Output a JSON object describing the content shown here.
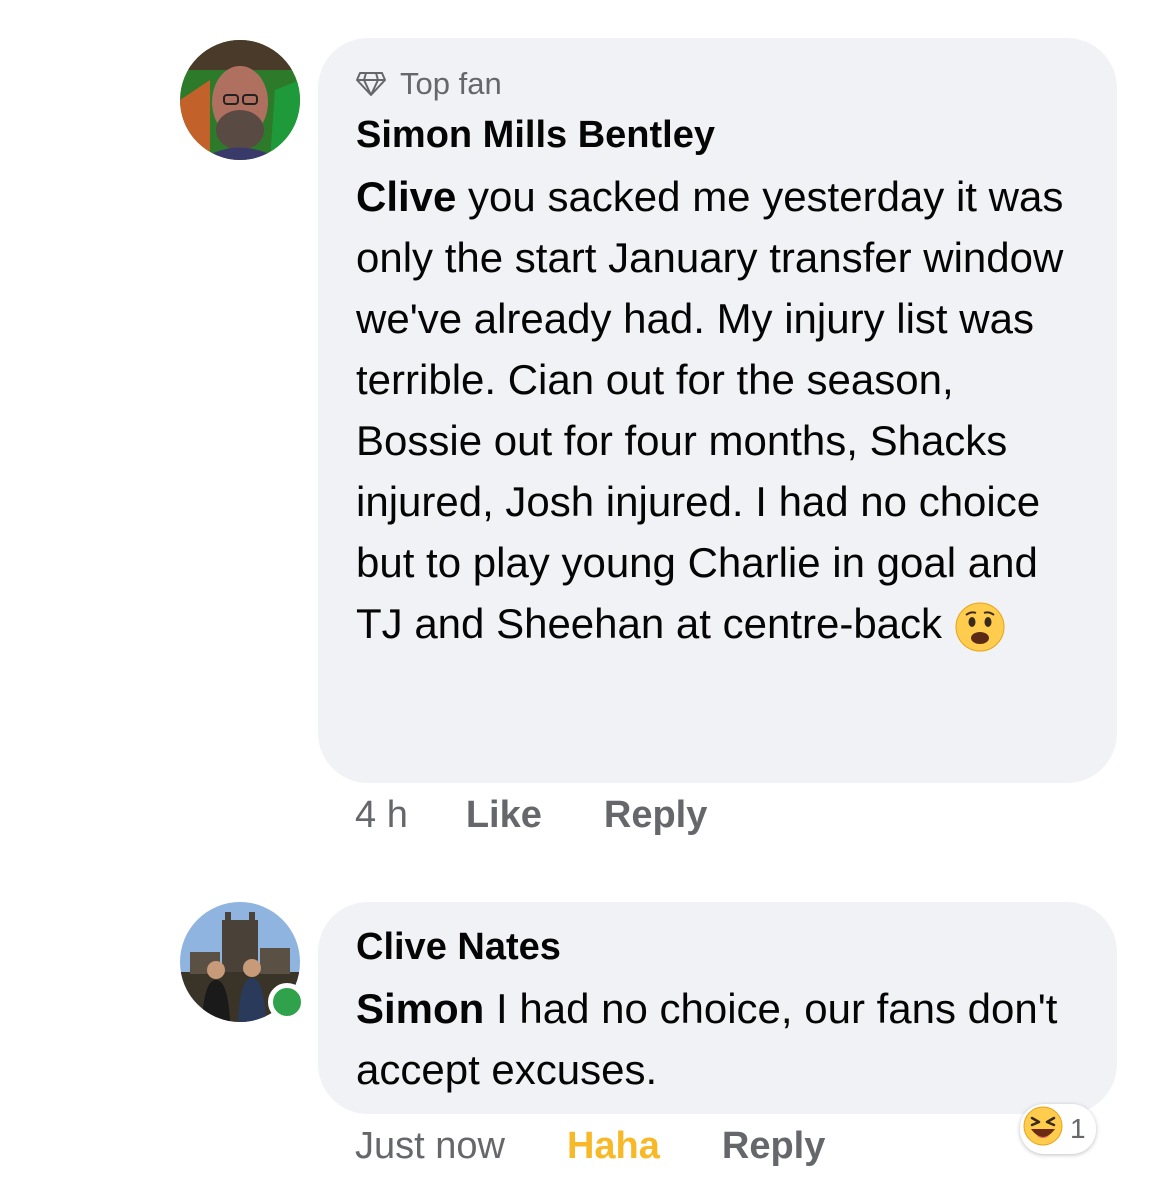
{
  "comments": [
    {
      "badge": "Top fan",
      "author": "Simon Mills Bentley",
      "mention": "Clive",
      "body": " you sacked me yesterday it was only the start January transfer window we've already had. My injury list was terrible. Cian out for the season, Bossie out for four months, Shacks injured, Josh injured. I had no choice but to play young Charlie in goal and TJ and Sheehan at centre-back",
      "emoji": "worried-face-emoji",
      "time": "4 h",
      "like_label": "Like",
      "reply_label": "Reply"
    },
    {
      "author": "Clive Nates",
      "mention": "Simon",
      "body": " I had no choice, our fans don't accept excuses.",
      "time": "Just now",
      "reaction_label": "Haha",
      "reply_label": "Reply",
      "reaction_count": "1",
      "reaction_icon": "laughing-face-emoji",
      "online": true
    }
  ],
  "colors": {
    "bubble": "#f0f2f5",
    "meta_text": "#65676b",
    "haha": "#f7b928",
    "online": "#31a24c"
  }
}
